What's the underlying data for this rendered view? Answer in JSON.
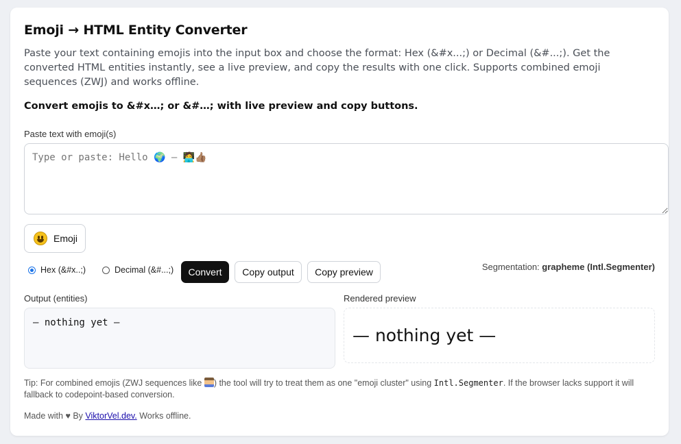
{
  "header": {
    "title": "Emoji → HTML Entity Converter",
    "description": "Paste your text containing emojis into the input box and choose the format: Hex (&#x...;) or Decimal (&#...;). Get the converted HTML entities instantly, see a live preview, and copy the results with one click. Supports combined emoji sequences (ZWJ) and works offline.",
    "tagline": "Convert emojis to &#x…; or &#…; with live preview and copy buttons."
  },
  "input": {
    "label": "Paste text with emoji(s)",
    "placeholder": "Type or paste: Hello 🌍 — 🧑‍💻👍🏽",
    "value": ""
  },
  "emoji_button": {
    "label": "Emoji",
    "icon": "smiley-face-icon"
  },
  "format": {
    "options": [
      {
        "label": "Hex (&#x..;)",
        "checked": true
      },
      {
        "label": "Decimal (&#...;)",
        "checked": false
      }
    ]
  },
  "buttons": {
    "convert": "Convert",
    "copy_output": "Copy output",
    "copy_preview": "Copy preview"
  },
  "segmentation": {
    "label": "Segmentation:",
    "value": "grapheme (Intl.Segmenter)"
  },
  "output": {
    "label": "Output (entities)",
    "value": "— nothing yet —"
  },
  "preview": {
    "label": "Rendered preview",
    "value": "— nothing yet —"
  },
  "tip": {
    "part1": "Tip: For combined emojis (ZWJ sequences like ",
    "part2": ") the tool will try to treat them as one \"emoji cluster\" using ",
    "code": "Intl.Segmenter",
    "part3": ". If the browser lacks support it will fallback to codepoint-based conversion."
  },
  "footer": {
    "made_with": "Made with ♥ By",
    "link": "ViktorVel.dev.",
    "suffix": "Works offline."
  },
  "colors": {
    "primary_button": "#111111",
    "radio_accent": "#1a73e8",
    "link": "#1a0dab"
  }
}
